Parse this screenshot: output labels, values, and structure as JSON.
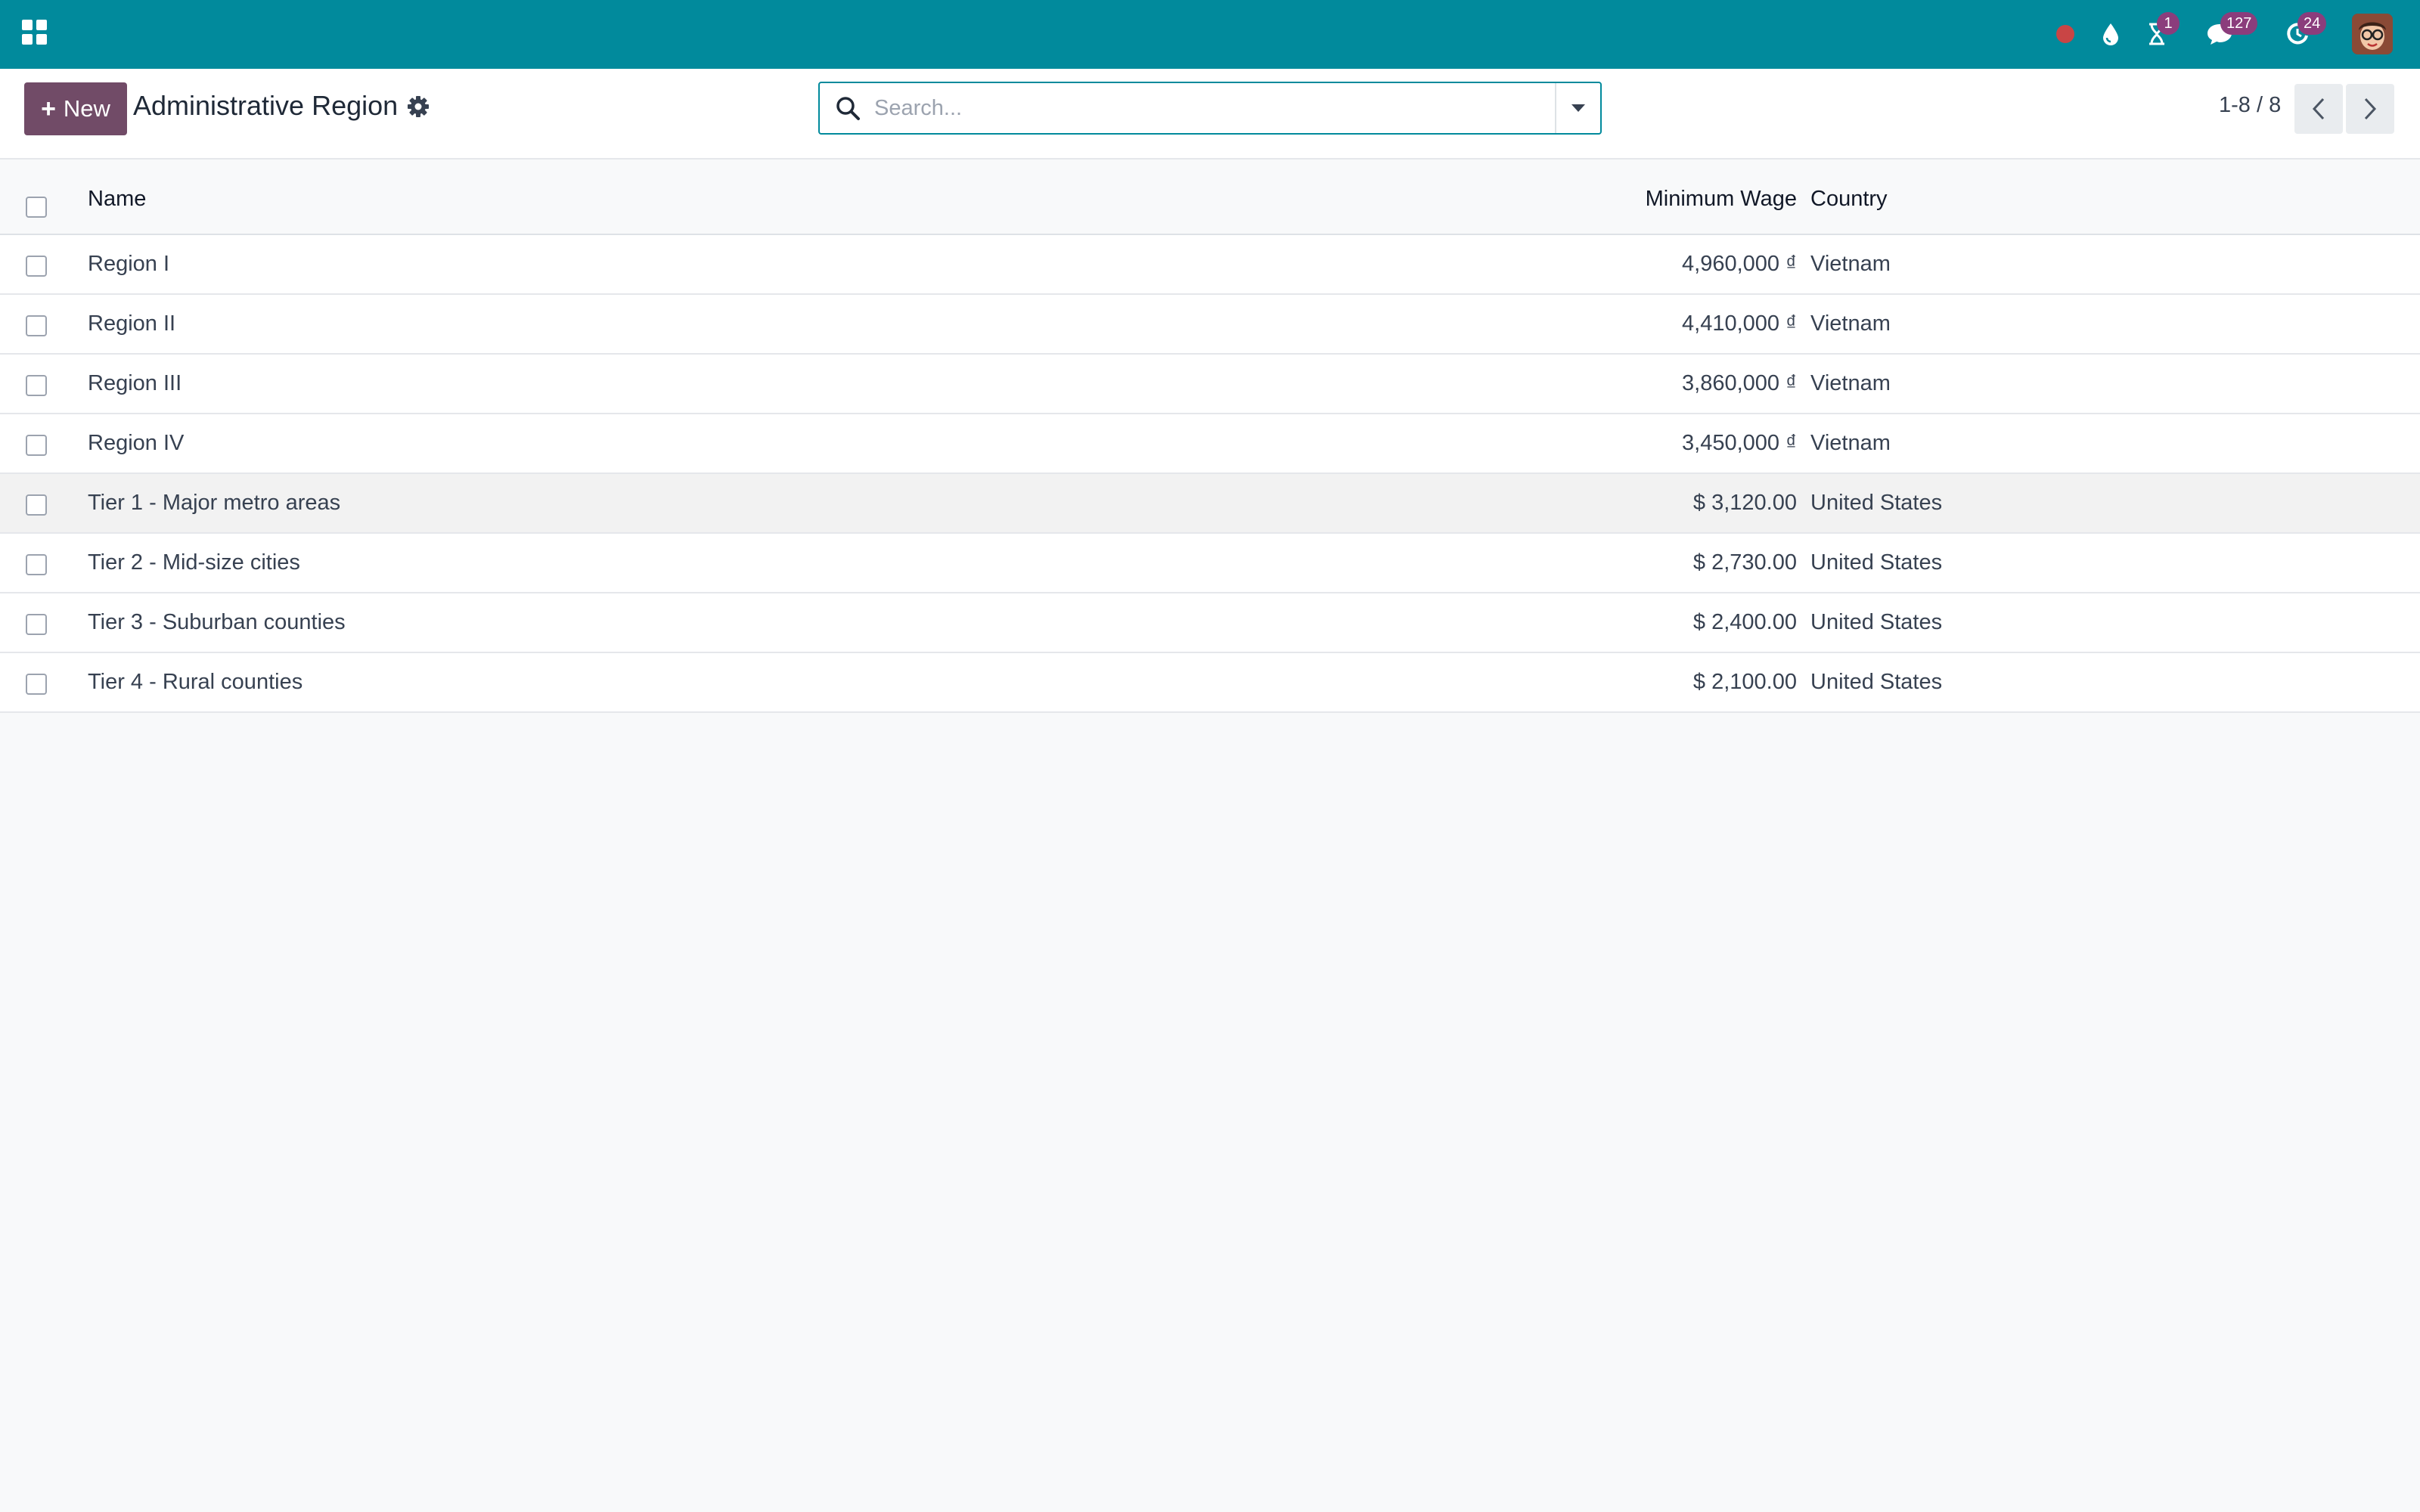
{
  "topbar": {
    "apps_icon": "apps-grid-icon",
    "badges": {
      "activities": "1",
      "messages": "127",
      "clock": "24"
    },
    "brand_color": "#018a9c",
    "badge_color": "#8b3d7c"
  },
  "control": {
    "new_label": "New",
    "title": "Administrative Region",
    "search_placeholder": "Search...",
    "pager_value": "1-8 / 8",
    "accent_color": "#714b67"
  },
  "list": {
    "columns": {
      "name": "Name",
      "wage": "Minimum Wage",
      "country": "Country"
    },
    "rows": [
      {
        "name": "Region I",
        "wage": "4,960,000 ₫",
        "country": "Vietnam"
      },
      {
        "name": "Region II",
        "wage": "4,410,000 ₫",
        "country": "Vietnam"
      },
      {
        "name": "Region III",
        "wage": "3,860,000 ₫",
        "country": "Vietnam"
      },
      {
        "name": "Region IV",
        "wage": "3,450,000 ₫",
        "country": "Vietnam"
      },
      {
        "name": "Tier 1 - Major metro areas",
        "wage": "$ 3,120.00",
        "country": "United States"
      },
      {
        "name": "Tier 2 - Mid-size cities",
        "wage": "$ 2,730.00",
        "country": "United States"
      },
      {
        "name": "Tier 3 - Suburban counties",
        "wage": "$ 2,400.00",
        "country": "United States"
      },
      {
        "name": "Tier 4 - Rural counties",
        "wage": "$ 2,100.00",
        "country": "United States"
      }
    ]
  }
}
